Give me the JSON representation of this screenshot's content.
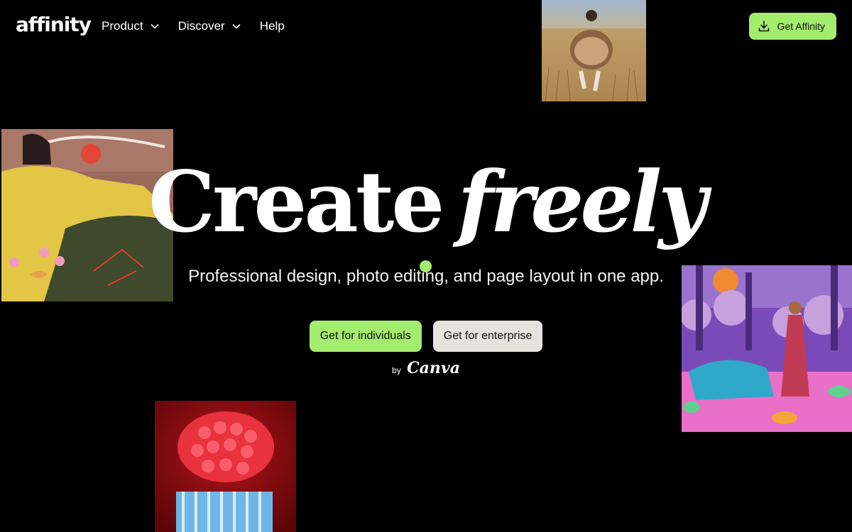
{
  "header": {
    "logo": "affinity",
    "nav": [
      {
        "label": "Product",
        "has_dropdown": true
      },
      {
        "label": "Discover",
        "has_dropdown": true
      },
      {
        "label": "Help",
        "has_dropdown": false
      }
    ],
    "cta": {
      "label": "Get Affinity",
      "icon": "download-icon"
    }
  },
  "hero": {
    "title_regular": "Create",
    "title_italic": "freely",
    "subtitle": "Professional design, photo editing, and page layout in one app.",
    "buttons": [
      {
        "label": "Get for individuals",
        "style": "primary"
      },
      {
        "label": "Get for enterprise",
        "style": "secondary"
      }
    ],
    "by_label": "by",
    "brand": "Canva"
  },
  "colors": {
    "background": "#000000",
    "accent_green": "#a3ec6e",
    "secondary_button": "#e6e2dc",
    "text": "#ffffff"
  }
}
